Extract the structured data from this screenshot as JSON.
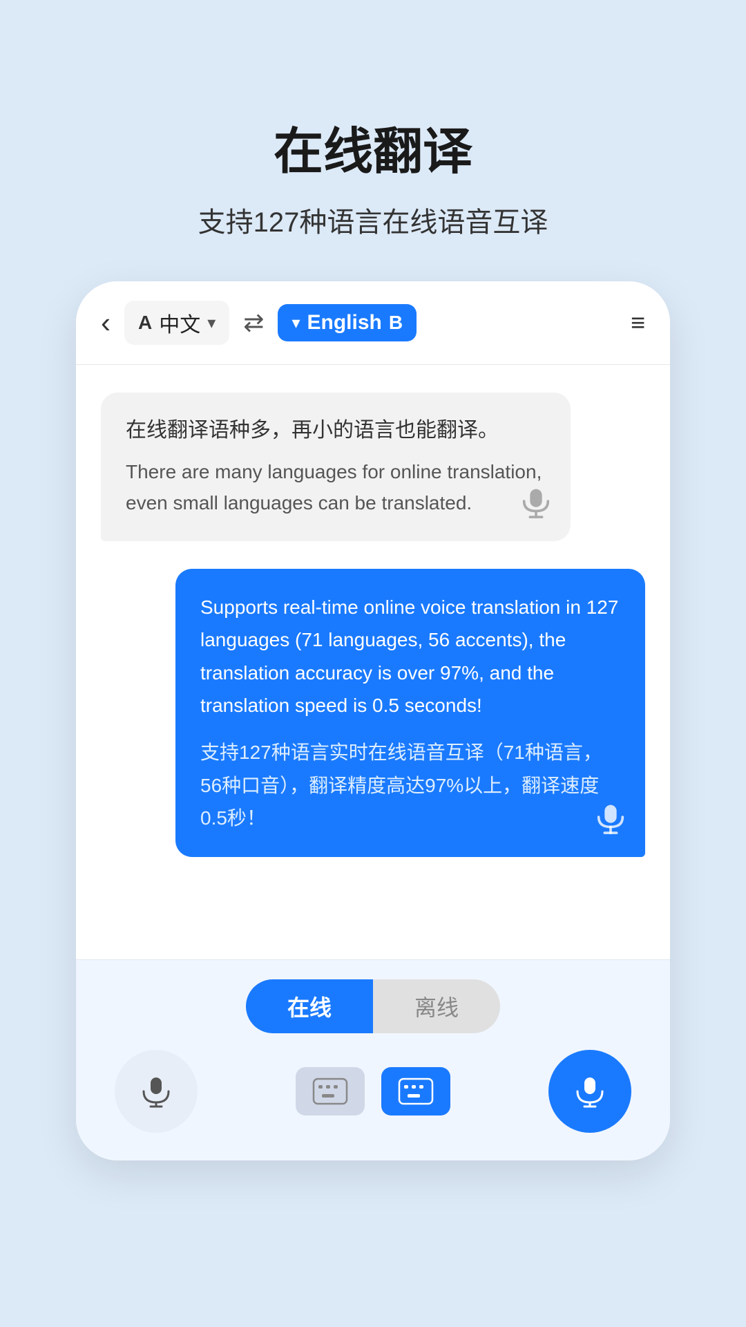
{
  "header": {
    "title": "在线翻译",
    "subtitle": "支持127种语言在线语音互译"
  },
  "topbar": {
    "back_label": "‹",
    "lang_a_badge": "A",
    "source_lang": "中文",
    "swap_icon": "⇄",
    "target_chevron": "▼",
    "target_lang": "English",
    "lang_b_badge": "B",
    "menu_icon": "≡"
  },
  "chat": {
    "bubble_left": {
      "source_text": "在线翻译语种多，再小的语言也能翻译。",
      "translated_text": "There are many languages for online translation, even small languages can be translated.",
      "speaker_icon": "🔊"
    },
    "bubble_right": {
      "english_text": "Supports real-time online voice translation in 127 languages (71 languages, 56 accents), the translation accuracy is over 97%, and the translation speed is 0.5 seconds!",
      "chinese_text": "支持127种语言实时在线语音互译（71种语言，56种口音），翻译精度高达97%以上，翻译速度0.5秒！",
      "speaker_icon": "🔊"
    }
  },
  "bottom": {
    "mode_online": "在线",
    "mode_offline": "离线"
  }
}
